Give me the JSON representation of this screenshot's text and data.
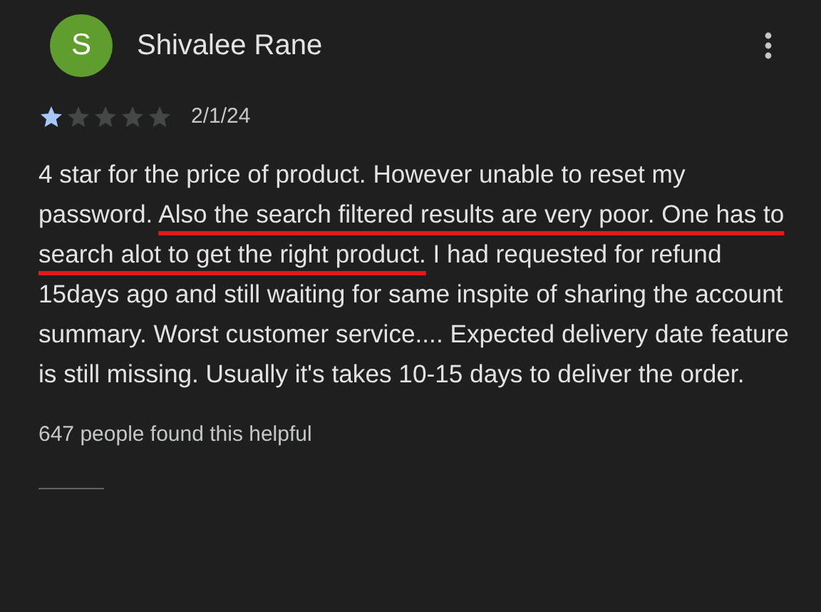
{
  "review": {
    "avatar_letter": "S",
    "author": "Shivalee Rane",
    "stars": 1,
    "date": "2/1/24",
    "text": [
      {
        "text": "4 star for the price of product. However unable to reset my password. ",
        "underlined": false
      },
      {
        "text": "Also the search filtered results are very poor. One has to search alot to get the right product.",
        "underlined": true
      },
      {
        "text": " I had requested for refund 15days ago and still waiting for same inspite of sharing the account summary. Worst customer service.... Expected delivery date feature is still missing. Usually it's takes 10-15 days to deliver the order.",
        "underlined": false
      }
    ],
    "helpful": "647 people found this helpful"
  }
}
